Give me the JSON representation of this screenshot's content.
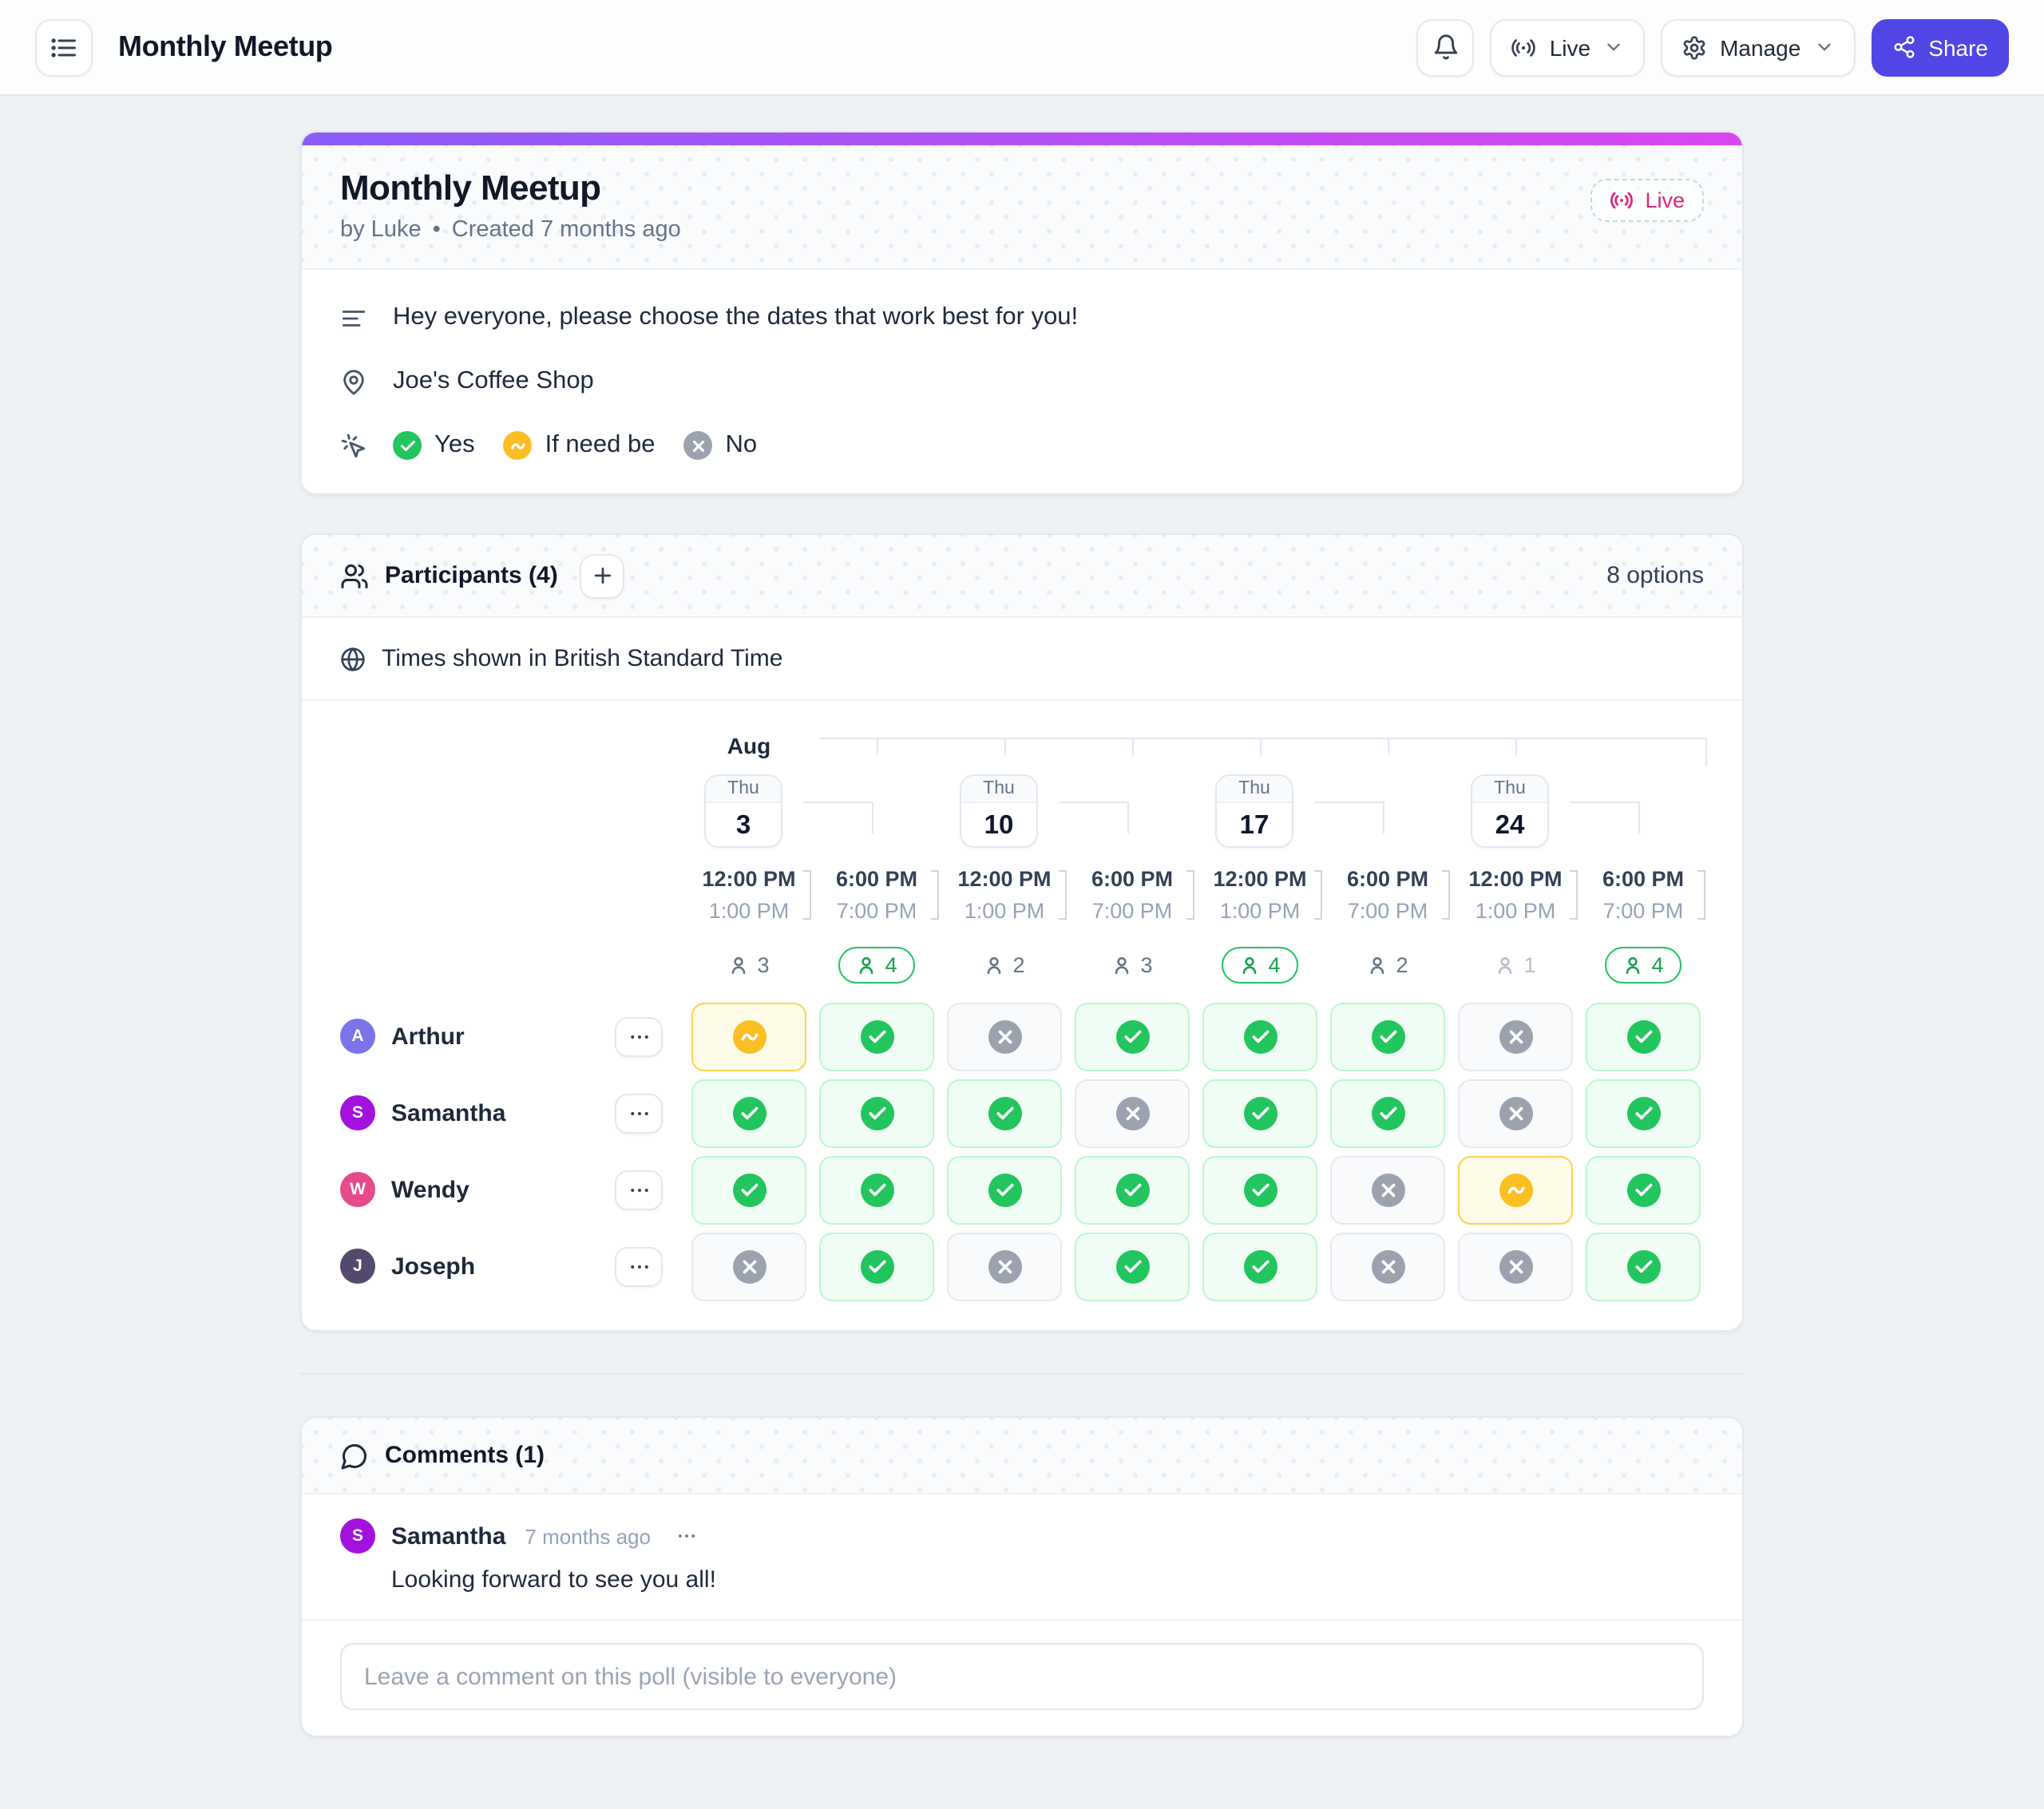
{
  "topbar": {
    "title": "Monthly Meetup",
    "live_label": "Live",
    "manage_label": "Manage",
    "share_label": "Share"
  },
  "poll": {
    "title": "Monthly Meetup",
    "byline_by": "by Luke",
    "byline_separator": "•",
    "byline_created": "Created 7 months ago",
    "live_badge_label": "Live",
    "description": "Hey everyone, please choose the dates that work best for you!",
    "location": "Joe's Coffee Shop",
    "legend": [
      {
        "value": "yes",
        "label": "Yes"
      },
      {
        "value": "ifNeedBe",
        "label": "If need be"
      },
      {
        "value": "no",
        "label": "No"
      }
    ]
  },
  "participants": {
    "title": "Participants (4)",
    "options_summary": "8 options",
    "timezone_note": "Times shown in British Standard Time",
    "month_label": "Aug",
    "dates": [
      {
        "dow": "Thu",
        "day": "3"
      },
      {
        "dow": "Thu",
        "day": "10"
      },
      {
        "dow": "Thu",
        "day": "17"
      },
      {
        "dow": "Thu",
        "day": "24"
      }
    ],
    "slots": [
      {
        "start": "12:00 PM",
        "end": "1:00 PM",
        "count": 3,
        "best": false
      },
      {
        "start": "6:00 PM",
        "end": "7:00 PM",
        "count": 4,
        "best": true
      },
      {
        "start": "12:00 PM",
        "end": "1:00 PM",
        "count": 2,
        "best": false
      },
      {
        "start": "6:00 PM",
        "end": "7:00 PM",
        "count": 3,
        "best": false
      },
      {
        "start": "12:00 PM",
        "end": "1:00 PM",
        "count": 4,
        "best": true
      },
      {
        "start": "6:00 PM",
        "end": "7:00 PM",
        "count": 2,
        "best": false
      },
      {
        "start": "12:00 PM",
        "end": "1:00 PM",
        "count": 1,
        "best": false
      },
      {
        "start": "6:00 PM",
        "end": "7:00 PM",
        "count": 4,
        "best": true
      }
    ],
    "rows": [
      {
        "name": "Arthur",
        "initial": "A",
        "color": "#7c74e8",
        "votes": [
          "ifNeedBe",
          "yes",
          "no",
          "yes",
          "yes",
          "yes",
          "no",
          "yes"
        ]
      },
      {
        "name": "Samantha",
        "initial": "S",
        "color": "#a312dd",
        "votes": [
          "yes",
          "yes",
          "yes",
          "no",
          "yes",
          "yes",
          "no",
          "yes"
        ]
      },
      {
        "name": "Wendy",
        "initial": "W",
        "color": "#e74a8b",
        "votes": [
          "yes",
          "yes",
          "yes",
          "yes",
          "yes",
          "no",
          "ifNeedBe",
          "yes"
        ]
      },
      {
        "name": "Joseph",
        "initial": "J",
        "color": "#544a6d",
        "votes": [
          "no",
          "yes",
          "no",
          "yes",
          "yes",
          "no",
          "no",
          "yes"
        ]
      }
    ]
  },
  "comments": {
    "title": "Comments (1)",
    "items": [
      {
        "author": "Samantha",
        "initial": "S",
        "color": "#a312dd",
        "time": "7 months ago",
        "text": "Looking forward to see you all!"
      }
    ],
    "composer_placeholder": "Leave a comment on this poll (visible to everyone)"
  },
  "colors": {
    "yes": "#22c55e",
    "ifNeedBe": "#fbbf24",
    "no": "#9ca3af",
    "accent": "#4f46e5",
    "live": "#db2777",
    "gradient_from": "#8b5cf6",
    "gradient_to": "#d946ef"
  }
}
